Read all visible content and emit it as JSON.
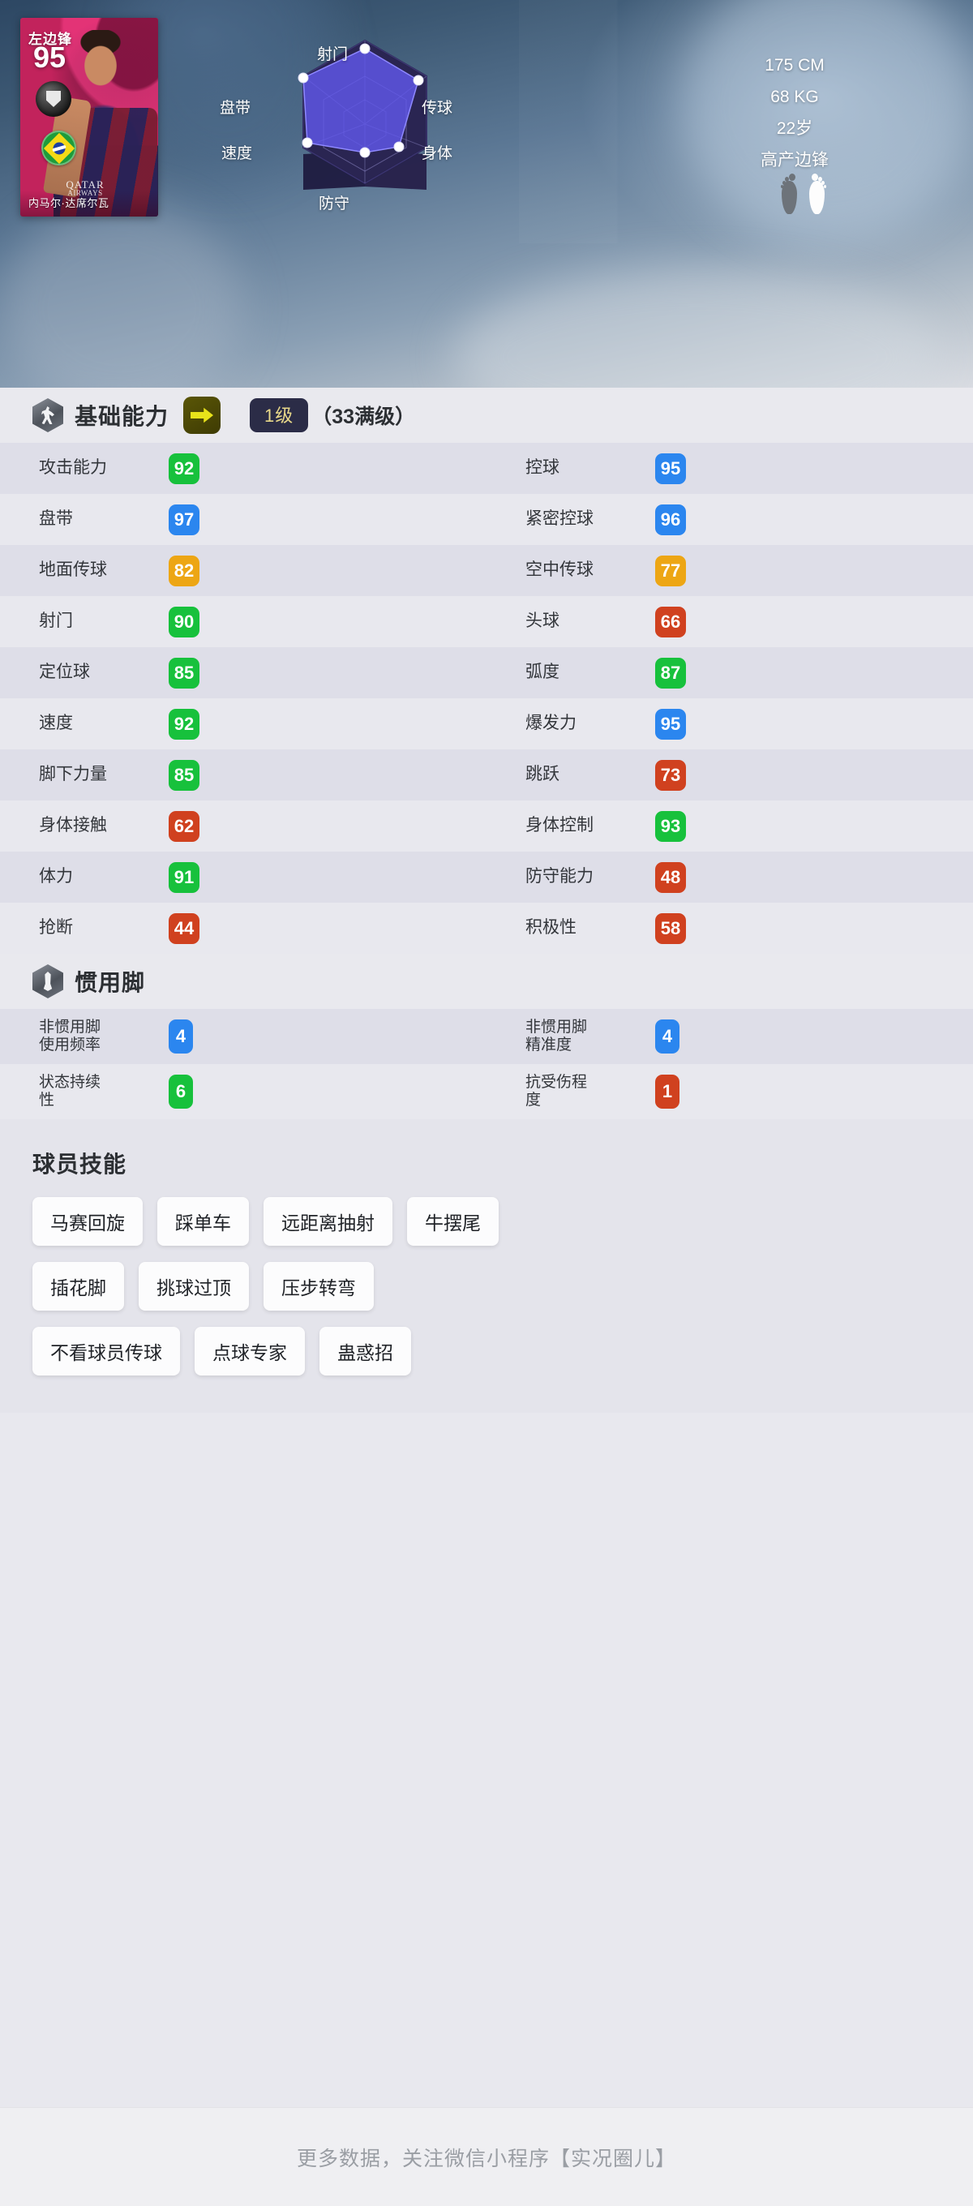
{
  "card": {
    "position": "左边锋",
    "rating": "95",
    "name": "内马尔·达席尔瓦",
    "club_sponsor": "QATAR",
    "club_sponsor_sub": "AIRWAYS",
    "nation_icon": "brazil-flag-icon",
    "club_icon": "club-badge-icon"
  },
  "bio": {
    "height": "175 CM",
    "weight": "68 KG",
    "age": "22岁",
    "play_style": "高产边锋",
    "strong_foot_icon": "footprints-icon"
  },
  "radar": {
    "labels": {
      "shooting": "射门",
      "dribbling": "盘带",
      "speed": "速度",
      "passing": "传球",
      "physical": "身体",
      "defending": "防守"
    }
  },
  "chart_data": {
    "type": "radar",
    "title": "",
    "axes": [
      "射门",
      "传球",
      "身体",
      "防守",
      "速度",
      "盘带"
    ],
    "values": [
      90,
      87,
      55,
      48,
      92,
      95
    ],
    "rlim": [
      0,
      100
    ],
    "grid": true,
    "fill_color": "#5f58f0",
    "outline_color": "#2b2756",
    "point_color": "#ffffff"
  },
  "basic": {
    "icon": "running-player-hex-icon",
    "title": "基础能力",
    "arrow_icon": "arrow-right-icon",
    "level_badge": "1级",
    "level_max": "（33满级）",
    "rows": [
      [
        {
          "name": "攻击能力",
          "value": "92",
          "color": "#17c13c"
        },
        {
          "name": "控球",
          "value": "95",
          "color": "#2b86ef"
        }
      ],
      [
        {
          "name": "盘带",
          "value": "97",
          "color": "#2b86ef"
        },
        {
          "name": "紧密控球",
          "value": "96",
          "color": "#2b86ef"
        }
      ],
      [
        {
          "name": "地面传球",
          "value": "82",
          "color": "#eda614"
        },
        {
          "name": "空中传球",
          "value": "77",
          "color": "#eda614"
        }
      ],
      [
        {
          "name": "射门",
          "value": "90",
          "color": "#17c13c"
        },
        {
          "name": "头球",
          "value": "66",
          "color": "#d0411f"
        }
      ],
      [
        {
          "name": "定位球",
          "value": "85",
          "color": "#17c13c"
        },
        {
          "name": "弧度",
          "value": "87",
          "color": "#17c13c"
        }
      ],
      [
        {
          "name": "速度",
          "value": "92",
          "color": "#17c13c"
        },
        {
          "name": "爆发力",
          "value": "95",
          "color": "#2b86ef"
        }
      ],
      [
        {
          "name": "脚下力量",
          "value": "85",
          "color": "#17c13c"
        },
        {
          "name": "跳跃",
          "value": "73",
          "color": "#d0411f"
        }
      ],
      [
        {
          "name": "身体接触",
          "value": "62",
          "color": "#d0411f"
        },
        {
          "name": "身体控制",
          "value": "93",
          "color": "#17c13c"
        }
      ],
      [
        {
          "name": "体力",
          "value": "91",
          "color": "#17c13c"
        },
        {
          "name": "防守能力",
          "value": "48",
          "color": "#d0411f"
        }
      ],
      [
        {
          "name": "抢断",
          "value": "44",
          "color": "#d0411f"
        },
        {
          "name": "积极性",
          "value": "58",
          "color": "#d0411f"
        }
      ]
    ]
  },
  "foot": {
    "icon": "boot-hex-icon",
    "title": "惯用脚",
    "rows": [
      [
        {
          "name": "非惯用脚\n使用频率",
          "value": "4",
          "color": "#2b86ef"
        },
        {
          "name": "非惯用脚\n精准度",
          "value": "4",
          "color": "#2b86ef"
        }
      ],
      [
        {
          "name": "状态持续\n性",
          "value": "6",
          "color": "#17c13c"
        },
        {
          "name": "抗受伤程\n度",
          "value": "1",
          "color": "#d0411f"
        }
      ]
    ]
  },
  "skills": {
    "title": "球员技能",
    "rows": [
      [
        "马赛回旋",
        "踩单车",
        "远距离抽射",
        "牛摆尾"
      ],
      [
        "插花脚",
        "挑球过顶",
        "压步转弯"
      ],
      [
        "不看球员传球",
        "点球专家",
        "蛊惑招"
      ]
    ]
  },
  "footer": {
    "text": "更多数据，关注微信小程序【实况圈儿】"
  }
}
